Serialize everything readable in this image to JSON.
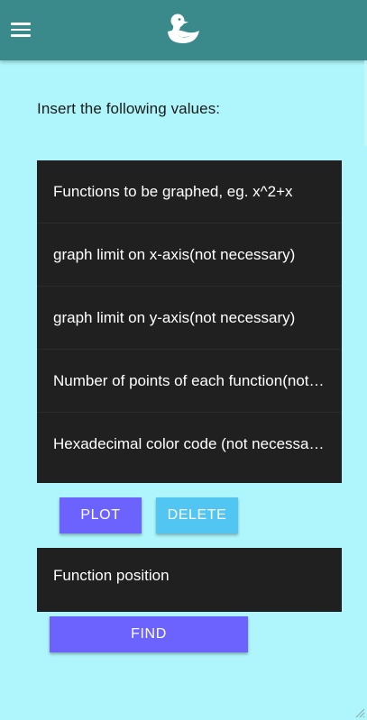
{
  "header": {
    "menu_icon": "hamburger-menu-icon",
    "logo_icon": "duck-logo-icon",
    "bg_color": "#3a8a8b"
  },
  "intro": "Insert the following values:",
  "form": {
    "fields": [
      {
        "placeholder": "Functions to be graphed, eg. x^2+x",
        "value": ""
      },
      {
        "placeholder": "graph limit on x-axis(not necessary)",
        "value": ""
      },
      {
        "placeholder": "graph limit on y-axis(not necessary)",
        "value": ""
      },
      {
        "placeholder": "Number of points of each function(not necessary)",
        "value": ""
      },
      {
        "placeholder": "Hexadecimal color code (not necessary)",
        "value": ""
      }
    ],
    "plot_label": "PLOT",
    "delete_label": "DELETE"
  },
  "find": {
    "placeholder": "Function position",
    "value": "",
    "button_label": "FIND"
  },
  "colors": {
    "page_bg": "#aef6fb",
    "panel_bg": "#202020",
    "primary": "#6c63ff",
    "secondary": "#51c6f2"
  }
}
